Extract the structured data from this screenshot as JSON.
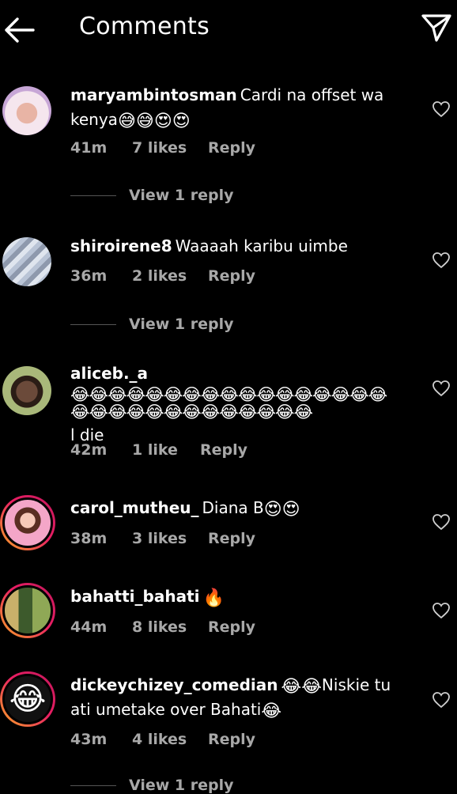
{
  "header": {
    "title": "Comments"
  },
  "comments": [
    {
      "username": "maryambintosman",
      "text": "Cardi na offset wa kenya",
      "emoji": "😅😅😍😍",
      "time": "41m",
      "likes": "7 likes",
      "reply": "Reply",
      "view_replies": "View 1 reply"
    },
    {
      "username": "shiroirene8",
      "text": "Waaaah karibu uimbe",
      "emoji": "",
      "time": "36m",
      "likes": "2 likes",
      "reply": "Reply",
      "view_replies": "View 1 reply"
    },
    {
      "username": "aliceb._a",
      "text_before": "",
      "emoji": "😂😂😂😂😂😂😂😂😂😂😂😂😂😂😂😂😂😂😂😂😂😂😂😂😂😂😂😂😂😂",
      "text": "l die",
      "time": "42m",
      "likes": "1 like",
      "reply": "Reply"
    },
    {
      "username": "carol_mutheu_",
      "text": "Diana B",
      "emoji": "😍😍",
      "time": "38m",
      "likes": "3 likes",
      "reply": "Reply"
    },
    {
      "username": "bahatti_bahati",
      "text": "",
      "emoji": "🔥",
      "time": "44m",
      "likes": "8 likes",
      "reply": "Reply"
    },
    {
      "username": "dickeychizey_comedian",
      "emoji_a": "😂😂",
      "text": "Niskie tu ati umetake over Bahati",
      "emoji": "😂",
      "time": "43m",
      "likes": "4 likes",
      "reply": "Reply",
      "view_replies": "View 1 reply"
    }
  ],
  "icons": {
    "back": "arrow-left-icon",
    "share": "paper-plane-icon",
    "like": "heart-outline-icon"
  },
  "colors": {
    "background": "#000000",
    "meta": "#a8a8a8",
    "story_ring_start": "#f9a825",
    "story_ring_end": "#c2185b"
  }
}
